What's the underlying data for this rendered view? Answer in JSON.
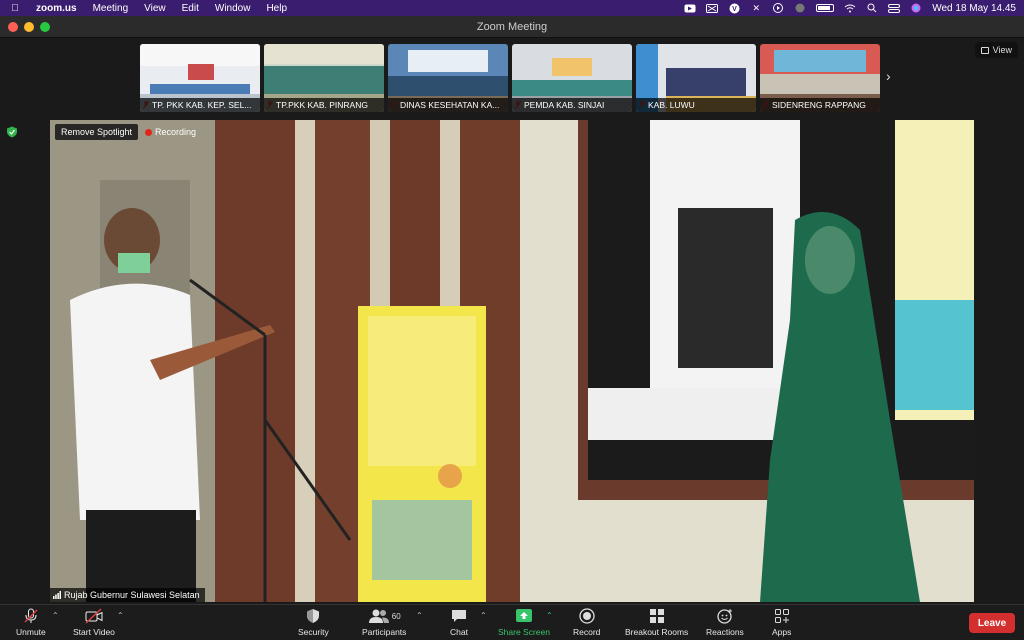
{
  "menubar": {
    "app": "zoom.us",
    "items": [
      "Meeting",
      "View",
      "Edit",
      "Window",
      "Help"
    ],
    "datetime": "Wed 18 May  14.45"
  },
  "window": {
    "title": "Zoom Meeting"
  },
  "thumbnails": [
    {
      "name": "TP. PKK KAB. KEP. SEL...",
      "muted": true
    },
    {
      "name": "TP.PKK KAB. PINRANG",
      "muted": true
    },
    {
      "name": "DINAS KESEHATAN KA...",
      "muted": true
    },
    {
      "name": "PEMDA KAB. SINJAI",
      "muted": true
    },
    {
      "name": "KAB. LUWU",
      "muted": true
    },
    {
      "name": "SIDENRENG RAPPANG",
      "muted": true
    }
  ],
  "view_button": "View",
  "spotlight": {
    "remove_label": "Remove Spotlight",
    "recording_label": "Recording",
    "speaker_name": "Rujab Gubernur Sulawesi Selatan"
  },
  "toolbar": {
    "unmute": "Unmute",
    "start_video": "Start Video",
    "security": "Security",
    "participants": "Participants",
    "participants_count": "60",
    "chat": "Chat",
    "share_screen": "Share Screen",
    "record": "Record",
    "breakout_rooms": "Breakout Rooms",
    "reactions": "Reactions",
    "apps": "Apps",
    "leave": "Leave"
  },
  "colors": {
    "menubar": "#3a1d6e",
    "leave": "#d32f2f",
    "share": "#39c36a",
    "recording": "#e0261c"
  }
}
